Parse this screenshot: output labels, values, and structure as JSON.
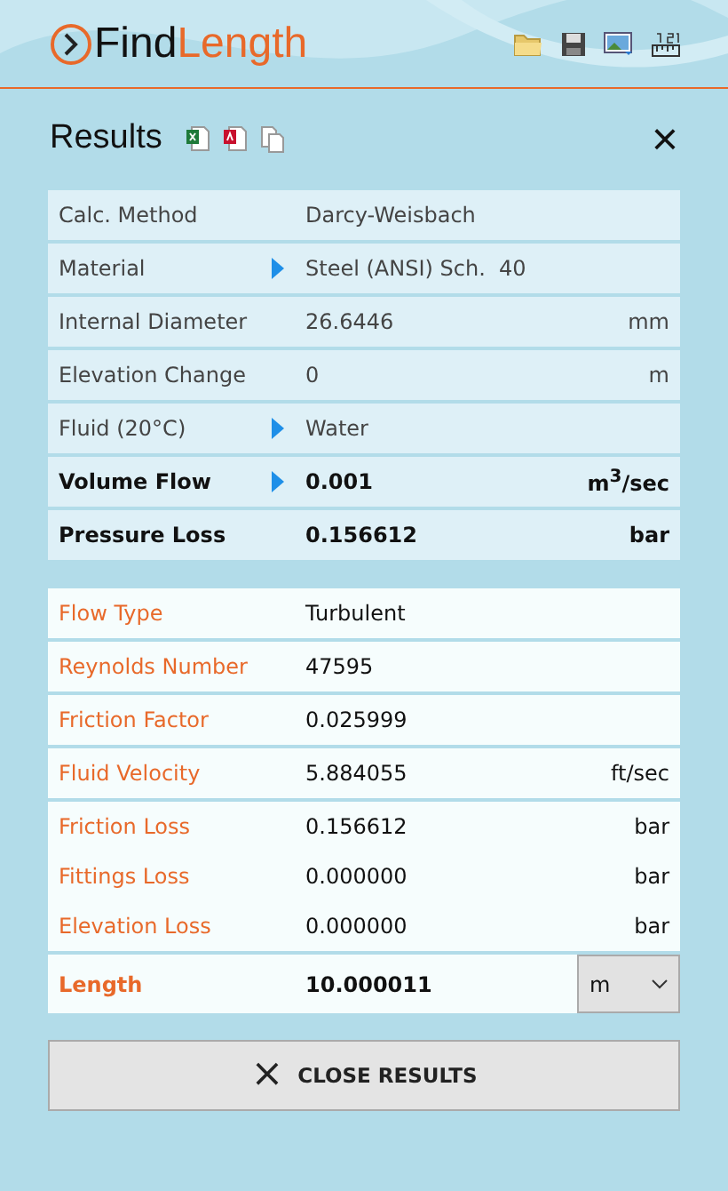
{
  "app": {
    "title_part1": "Find",
    "title_part2": "Length"
  },
  "panel": {
    "title": "Results",
    "close": "×"
  },
  "inputs": [
    {
      "label": "Calc. Method",
      "value": "Darcy-Weisbach",
      "picker": false,
      "kind": "plain"
    },
    {
      "label": "Material",
      "value": "Steel (ANSI) Sch.  40",
      "picker": true,
      "kind": "plain"
    },
    {
      "label": "Internal Diameter",
      "value": "26.6446",
      "unit": "mm",
      "picker": false,
      "kind": "plain"
    },
    {
      "label": "Elevation Change",
      "value": "0",
      "unit": "m",
      "picker": false,
      "kind": "plain"
    },
    {
      "label": "Fluid (20°C)",
      "value": "Water",
      "picker": true,
      "kind": "plain"
    },
    {
      "label": "Volume Flow",
      "value": "0.001",
      "unit": "m$^{3}$/sec",
      "picker": true,
      "kind": "key"
    },
    {
      "label": "Pressure Loss",
      "value": "0.156612",
      "unit": "bar",
      "picker": false,
      "kind": "key"
    }
  ],
  "result_groups": [
    [
      {
        "label": "Flow Type",
        "value": "Turbulent",
        "kind": "plain"
      }
    ],
    [
      {
        "label": "Reynolds Number",
        "value": "47595",
        "kind": "plain"
      }
    ],
    [
      {
        "label": "Friction Factor",
        "value": "0.025999",
        "kind": "plain"
      }
    ],
    [
      {
        "label": "Fluid Velocity",
        "value": "5.884055",
        "unit": "ft/sec",
        "kind": "plain"
      }
    ],
    [
      {
        "label": "Friction Loss",
        "value": "0.156612",
        "unit": "bar",
        "kind": "plain"
      },
      {
        "label": "Fittings Loss",
        "value": "0.000000",
        "unit": "bar",
        "kind": "plain"
      },
      {
        "label": "Elevation Loss",
        "value": "0.000000",
        "unit": "bar",
        "kind": "plain"
      }
    ],
    [
      {
        "label": "Length",
        "value": "10.000011",
        "unit_select": "m",
        "kind": "key"
      }
    ]
  ],
  "close_button": {
    "label": "CLOSE RESULTS",
    "icon": "×"
  }
}
